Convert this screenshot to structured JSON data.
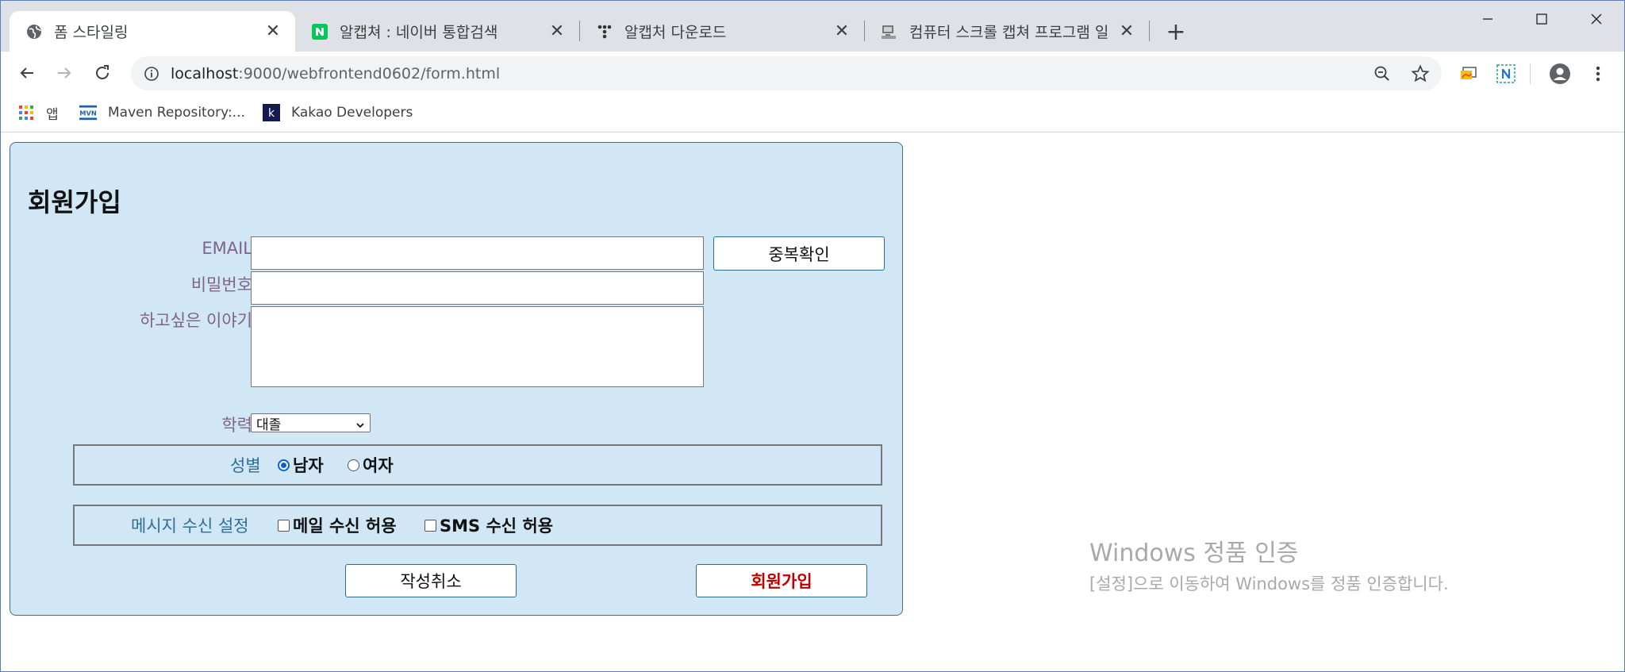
{
  "tabs": [
    {
      "title": "폼 스타일링",
      "active": true
    },
    {
      "title": "알캡쳐 : 네이버 통합검색",
      "active": false
    },
    {
      "title": "알캡처 다운로드",
      "active": false
    },
    {
      "title": "컴퓨터 스크롤 캡쳐 프로그램 일",
      "active": false
    }
  ],
  "address_bar": {
    "host": "localhost",
    "path": ":9000/webfrontend0602/form.html"
  },
  "bookmarks": [
    {
      "label": "앱"
    },
    {
      "label": "Maven Repository:..."
    },
    {
      "label": "Kakao Developers"
    }
  ],
  "form": {
    "title": "회원가입",
    "email_label": "EMAIL",
    "email_value": "",
    "dup_check_button": "중복확인",
    "password_label": "비밀번호",
    "password_value": "",
    "message_label": "하고싶은 이야기",
    "message_value": "",
    "education_label": "학력",
    "education_selected": "대졸",
    "gender_label": "성별",
    "gender_options": [
      {
        "label": "남자",
        "checked": true
      },
      {
        "label": "여자",
        "checked": false
      }
    ],
    "notify_label": "메시지 수신 설정",
    "notify_options": [
      {
        "label": "메일 수신 허용",
        "checked": false
      },
      {
        "label": "SMS 수신 허용",
        "checked": false
      }
    ],
    "cancel_button": "작성취소",
    "submit_button": "회원가입"
  },
  "watermark": {
    "title": "Windows 정품 인증",
    "subtitle": "[설정]으로 이동하여 Windows를 정품 인증합니다."
  },
  "colors": {
    "panel_bg": "#d1e7f5",
    "label_purple": "#80638a",
    "label_blue": "#2f6f95",
    "submit_red": "#c00000"
  }
}
